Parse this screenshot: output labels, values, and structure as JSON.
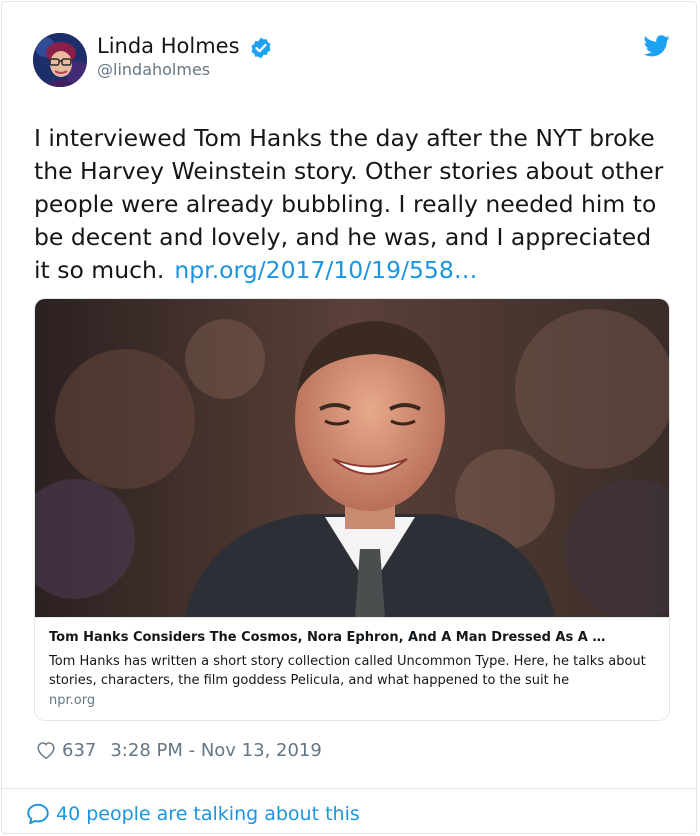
{
  "author": {
    "name": "Linda Holmes",
    "handle": "@lindaholmes",
    "verified": true
  },
  "tweet": {
    "text": "I interviewed Tom Hanks the day after the NYT broke the Harvey Weinstein story. Other stories about other people were already bubbling. I really needed him to be decent and lovely, and he was, and I appreciated it so much.",
    "link_text": "npr.org/2017/10/19/558…"
  },
  "card": {
    "title": "Tom Hanks Considers The Cosmos, Nora Ephron, And A Man Dressed As A …",
    "description": "Tom Hanks has written a short story collection called Uncommon Type. Here, he talks about stories, characters, the film goddess Pelicula, and what happened to the suit he",
    "domain": "npr.org"
  },
  "meta": {
    "likes": "637",
    "timestamp": "3:28 PM - Nov 13, 2019"
  },
  "footer": {
    "conversation": "40 people are talking about this"
  },
  "icons": {
    "brand": "twitter-bird-icon",
    "verified": "verified-badge-icon",
    "like": "heart-icon",
    "reply": "speech-bubble-icon"
  },
  "colors": {
    "link": "#1b95e0",
    "verified": "#1da1f2",
    "muted": "#657786",
    "border": "#e1e8ed"
  }
}
